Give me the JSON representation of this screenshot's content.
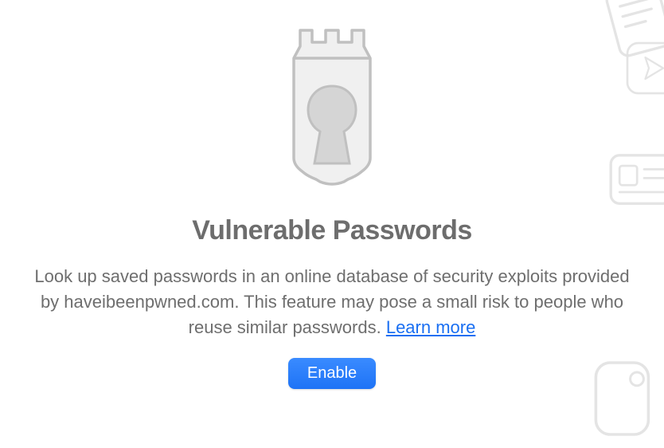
{
  "main": {
    "heading": "Vulnerable Passwords",
    "description": "Look up saved passwords in an online database of security exploits provided by haveibeenpwned.com. This feature may pose a small risk to people who reuse similar passwords. ",
    "learn_more": "Learn more",
    "enable_button": "Enable"
  }
}
